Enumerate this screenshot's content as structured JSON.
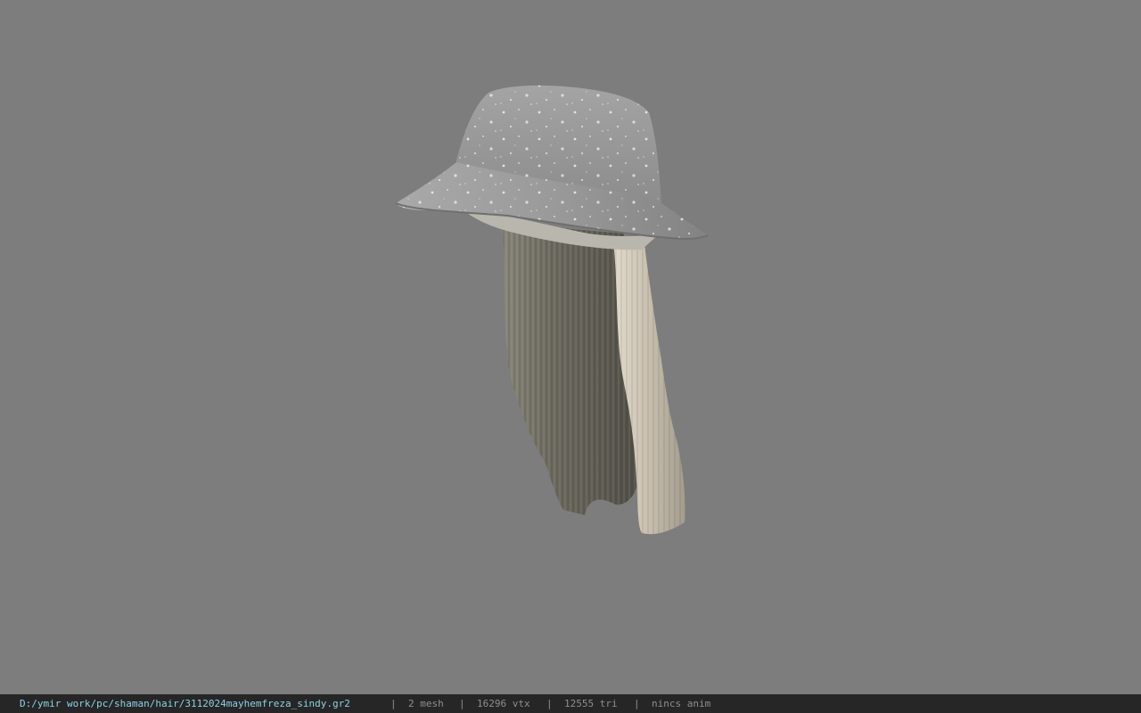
{
  "viewport": {
    "background_color": "#7d7d7d",
    "model_icon": "hat-with-hair-model"
  },
  "statusbar": {
    "file_path": "D:/ymir work/pc/shaman/hair/3112024mayhemfreza_sindy.gr2",
    "separator": "|",
    "mesh_count": "2 mesh",
    "vertex_count": "16296 vtx",
    "triangle_count": "12555 tri",
    "anim_status": "nincs anim",
    "path_color": "#8fd0e8",
    "background_color": "#262626"
  }
}
